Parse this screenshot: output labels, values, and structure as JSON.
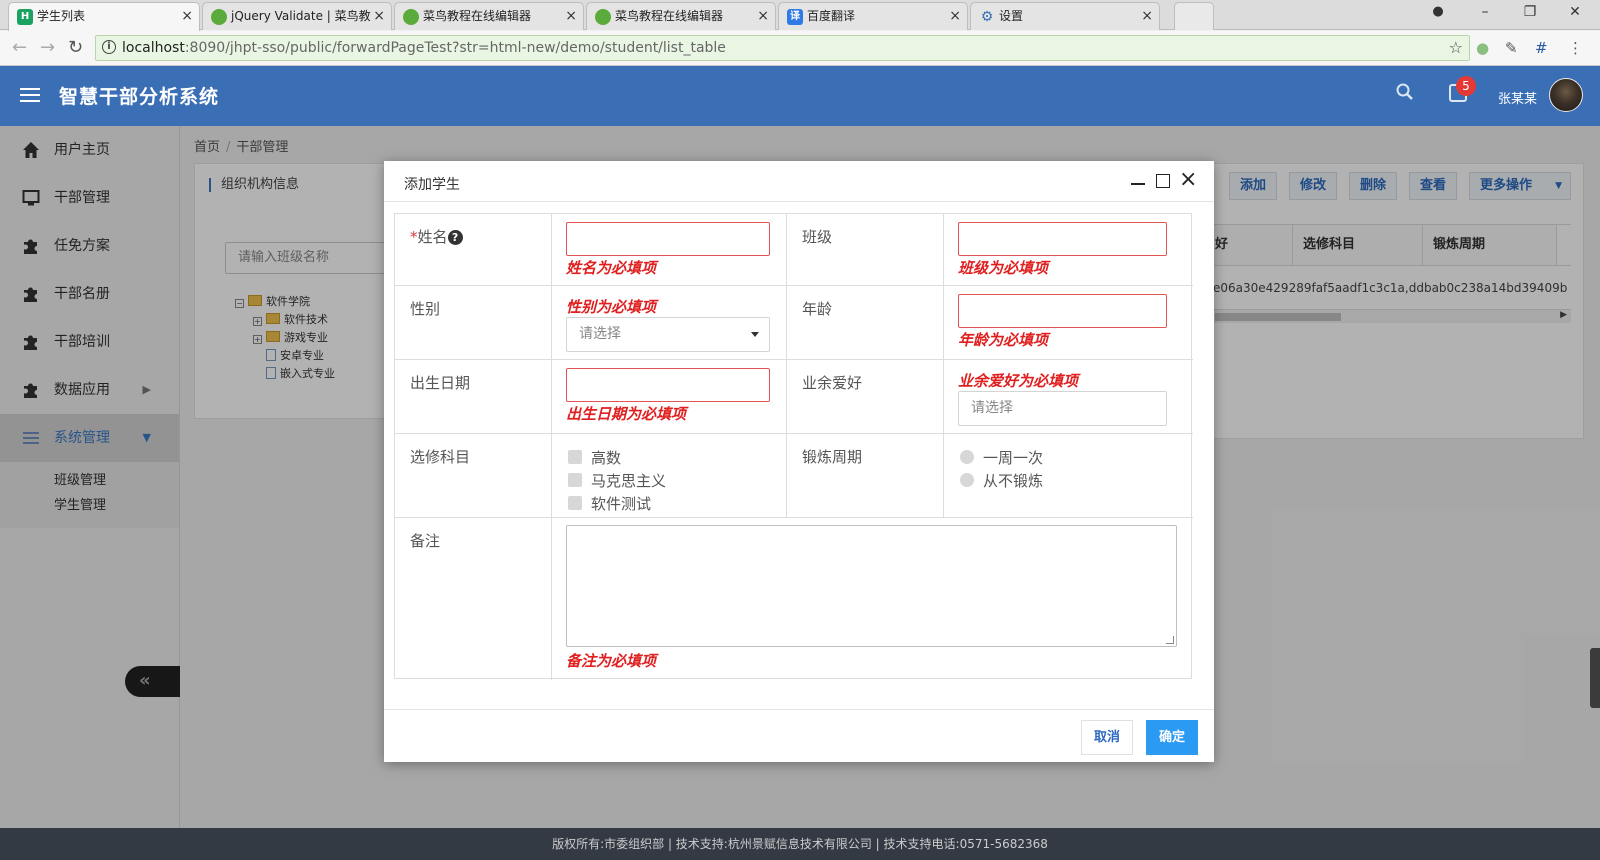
{
  "browser": {
    "tabs": [
      {
        "title": "学生列表",
        "favicon": "H"
      },
      {
        "title": "jQuery Validate | 菜鸟教",
        "favicon": "runoob"
      },
      {
        "title": "菜鸟教程在线编辑器",
        "favicon": "runoob"
      },
      {
        "title": "菜鸟教程在线编辑器",
        "favicon": "runoob"
      },
      {
        "title": "百度翻译",
        "favicon": "译"
      },
      {
        "title": "设置",
        "favicon": "gear"
      }
    ],
    "url_host": "localhost",
    "url_rest": ":8090/jhpt-sso/public/forwardPageTest?str=html-new/demo/student/list_table"
  },
  "header": {
    "app_title": "智慧干部分析系统",
    "notification_count": "5",
    "username": "张某某"
  },
  "sidebar": {
    "items": [
      {
        "label": "用户主页",
        "icon": "home-icon"
      },
      {
        "label": "干部管理",
        "icon": "monitor-icon"
      },
      {
        "label": "任免方案",
        "icon": "puzzle-icon"
      },
      {
        "label": "干部名册",
        "icon": "puzzle-icon"
      },
      {
        "label": "干部培训",
        "icon": "puzzle-icon"
      },
      {
        "label": "数据应用",
        "icon": "puzzle-icon"
      },
      {
        "label": "系统管理",
        "icon": "list-icon"
      }
    ],
    "sub_items": [
      "班级管理",
      "学生管理"
    ],
    "collapse_label": "«"
  },
  "breadcrumb": {
    "home": "首页",
    "current": "干部管理"
  },
  "left_panel": {
    "title": "组织机构信息",
    "search_placeholder": "请输入班级名称",
    "tree": {
      "root": "软件学院",
      "children": [
        "软件技术",
        "游戏专业",
        "安卓专业",
        "嵌入式专业"
      ]
    }
  },
  "right_panel": {
    "toolbar": {
      "add": "添加",
      "edit": "修改",
      "delete": "删除",
      "view": "查看",
      "more": "更多操作"
    },
    "columns": [
      "好",
      "选修科目",
      "锻炼周期"
    ],
    "row": "e06a30e429289faf5aadf1c3c1a,ddbab0c238a14bd39409b"
  },
  "modal": {
    "title": "添加学生",
    "fields": {
      "name": {
        "required_mark": "*",
        "label": "姓名",
        "help": "?",
        "error": "姓名为必填项"
      },
      "class": {
        "label": "班级",
        "error": "班级为必填项"
      },
      "gender": {
        "label": "性别",
        "error": "性别为必填项",
        "placeholder": "请选择"
      },
      "age": {
        "label": "年龄",
        "error": "年龄为必填项"
      },
      "birthdate": {
        "label": "出生日期",
        "error": "出生日期为必填项"
      },
      "hobby": {
        "label": "业余爱好",
        "error": "业余爱好为必填项",
        "placeholder": "请选择"
      },
      "electives": {
        "label": "选修科目",
        "options": [
          "高数",
          "马克思主义",
          "软件测试"
        ]
      },
      "exercise": {
        "label": "锻炼周期",
        "options": [
          "一周一次",
          "从不锻炼"
        ]
      },
      "remark": {
        "label": "备注",
        "error": "备注为必填项"
      }
    },
    "cancel": "取消",
    "confirm": "确定"
  },
  "footer": {
    "text": "版权所有:市委组织部 | 技术支持:杭州景赋信息技术有限公司 | 技术支持电话:0571-5682368"
  }
}
